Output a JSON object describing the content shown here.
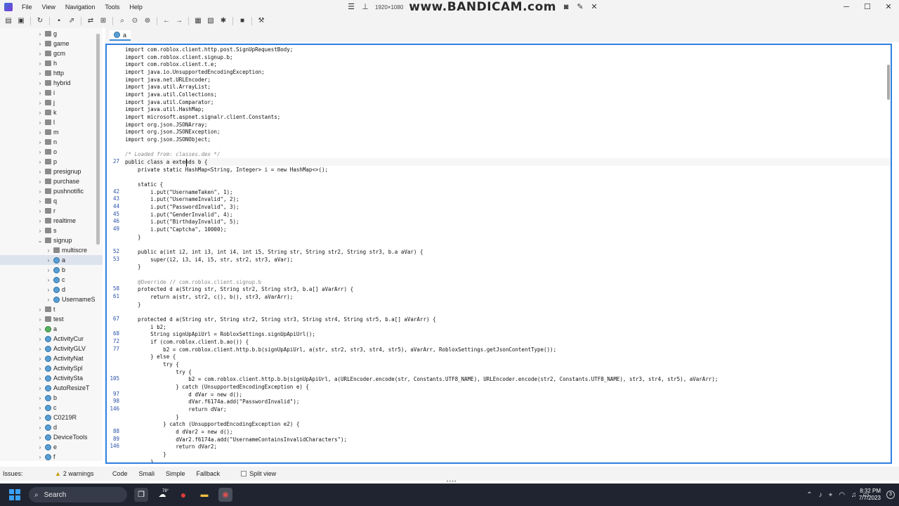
{
  "menubar": {
    "items": [
      "File",
      "View",
      "Navigation",
      "Tools",
      "Help"
    ]
  },
  "recorder": {
    "resolution": "1920×1080",
    "watermark": "www.BANDICAM.com"
  },
  "window_controls": {
    "minimize": "─",
    "maximize": "☐",
    "close": "✕"
  },
  "sidebar": {
    "items": [
      {
        "label": "g",
        "type": "package"
      },
      {
        "label": "game",
        "type": "package"
      },
      {
        "label": "gcm",
        "type": "package"
      },
      {
        "label": "h",
        "type": "package"
      },
      {
        "label": "http",
        "type": "package"
      },
      {
        "label": "hybrid",
        "type": "package"
      },
      {
        "label": "i",
        "type": "package"
      },
      {
        "label": "j",
        "type": "package"
      },
      {
        "label": "k",
        "type": "package"
      },
      {
        "label": "l",
        "type": "package"
      },
      {
        "label": "m",
        "type": "package"
      },
      {
        "label": "n",
        "type": "package"
      },
      {
        "label": "o",
        "type": "package"
      },
      {
        "label": "p",
        "type": "package"
      },
      {
        "label": "presignup",
        "type": "package"
      },
      {
        "label": "purchase",
        "type": "package"
      },
      {
        "label": "pushnotific",
        "type": "package"
      },
      {
        "label": "q",
        "type": "package"
      },
      {
        "label": "r",
        "type": "package"
      },
      {
        "label": "realtime",
        "type": "package"
      },
      {
        "label": "s",
        "type": "package"
      },
      {
        "label": "signup",
        "type": "package-open"
      },
      {
        "label": "multiscre",
        "type": "package"
      },
      {
        "label": "a",
        "type": "class-selected"
      },
      {
        "label": "b",
        "type": "class"
      },
      {
        "label": "c",
        "type": "class"
      },
      {
        "label": "d",
        "type": "class"
      },
      {
        "label": "UsernameS",
        "type": "class"
      },
      {
        "label": "t",
        "type": "package"
      },
      {
        "label": "test",
        "type": "package"
      },
      {
        "label": "a",
        "type": "class-green"
      },
      {
        "label": "ActivityCur",
        "type": "class"
      },
      {
        "label": "ActivityGLV",
        "type": "class"
      },
      {
        "label": "ActivityNat",
        "type": "class"
      },
      {
        "label": "ActivitySpl",
        "type": "class"
      },
      {
        "label": "ActivitySta",
        "type": "class"
      },
      {
        "label": "AutoResizeT",
        "type": "class"
      },
      {
        "label": "b",
        "type": "class"
      },
      {
        "label": "c",
        "type": "class"
      },
      {
        "label": "C0219R",
        "type": "class"
      },
      {
        "label": "d",
        "type": "class"
      },
      {
        "label": "DeviceTools",
        "type": "class"
      },
      {
        "label": "e",
        "type": "class"
      },
      {
        "label": "f",
        "type": "class"
      }
    ]
  },
  "tabs": [
    {
      "label": "a"
    }
  ],
  "code": {
    "lines": [
      {
        "n": "",
        "text": "import com.roblox.client.http.post.SignUpRequestBody;"
      },
      {
        "n": "",
        "text": "import com.roblox.client.signup.b;"
      },
      {
        "n": "",
        "text": "import com.roblox.client.t.e;"
      },
      {
        "n": "",
        "text": "import java.io.UnsupportedEncodingException;"
      },
      {
        "n": "",
        "text": "import java.net.URLEncoder;"
      },
      {
        "n": "",
        "text": "import java.util.ArrayList;"
      },
      {
        "n": "",
        "text": "import java.util.Collections;"
      },
      {
        "n": "",
        "text": "import java.util.Comparator;"
      },
      {
        "n": "",
        "text": "import java.util.HashMap;"
      },
      {
        "n": "",
        "text": "import microsoft.aspnet.signalr.client.Constants;"
      },
      {
        "n": "",
        "text": "import org.json.JSONArray;"
      },
      {
        "n": "",
        "text": "import org.json.JSONException;"
      },
      {
        "n": "",
        "text": "import org.json.JSONObject;"
      },
      {
        "n": "",
        "text": ""
      },
      {
        "n": "",
        "text": "/* Loaded from: classes.dex */",
        "kind": "comment"
      },
      {
        "n": "27",
        "text": "public class a extends b {",
        "kind": "hl"
      },
      {
        "n": "",
        "text": "    private static HashMap<String, Integer> i = new HashMap<>();"
      },
      {
        "n": "",
        "text": ""
      },
      {
        "n": "",
        "text": "    static {"
      },
      {
        "n": "42",
        "text": "        i.put(\"UsernameTaken\", 1);"
      },
      {
        "n": "43",
        "text": "        i.put(\"UsernameInvalid\", 2);"
      },
      {
        "n": "44",
        "text": "        i.put(\"PasswordInvalid\", 3);"
      },
      {
        "n": "45",
        "text": "        i.put(\"GenderInvalid\", 4);"
      },
      {
        "n": "46",
        "text": "        i.put(\"BirthdayInvalid\", 5);"
      },
      {
        "n": "49",
        "text": "        i.put(\"Captcha\", 10000);"
      },
      {
        "n": "",
        "text": "    }"
      },
      {
        "n": "",
        "text": ""
      },
      {
        "n": "52",
        "text": "    public a(int i2, int i3, int i4, int i5, String str, String str2, String str3, b.a aVar) {"
      },
      {
        "n": "53",
        "text": "        super(i2, i3, i4, i5, str, str2, str3, aVar);"
      },
      {
        "n": "",
        "text": "    }"
      },
      {
        "n": "",
        "text": ""
      },
      {
        "n": "",
        "text": "    @Override // com.roblox.client.signup.b",
        "kind": "anno"
      },
      {
        "n": "58",
        "text": "    protected d a(String str, String str2, String str3, b.a[] aVarArr) {"
      },
      {
        "n": "61",
        "text": "        return a(str, str2, c(), b(), str3, aVarArr);"
      },
      {
        "n": "",
        "text": "    }"
      },
      {
        "n": "",
        "text": ""
      },
      {
        "n": "67",
        "text": "    protected d a(String str, String str2, String str3, String str4, String str5, b.a[] aVarArr) {"
      },
      {
        "n": "",
        "text": "        i b2;"
      },
      {
        "n": "68",
        "text": "        String signUpApiUrl = RobloxSettings.signUpApiUrl();"
      },
      {
        "n": "72",
        "text": "        if (com.roblox.client.b.ao()) {"
      },
      {
        "n": "77",
        "text": "            b2 = com.roblox.client.http.b.b(signUpApiUrl, a(str, str2, str3, str4, str5), aVarArr, RobloxSettings.getJsonContentType());"
      },
      {
        "n": "",
        "text": "        } else {"
      },
      {
        "n": "",
        "text": "            try {"
      },
      {
        "n": "",
        "text": "                try {"
      },
      {
        "n": "105",
        "text": "                    b2 = com.roblox.client.http.b.b(signUpApiUrl, a(URLEncoder.encode(str, Constants.UTF8_NAME), URLEncoder.encode(str2, Constants.UTF8_NAME), str3, str4, str5), aVarArr);"
      },
      {
        "n": "",
        "text": "                } catch (UnsupportedEncodingException e) {"
      },
      {
        "n": "97",
        "text": "                    d dVar = new d();"
      },
      {
        "n": "98",
        "text": "                    dVar.f6174a.add(\"PasswordInvalid\");"
      },
      {
        "n": "146",
        "text": "                    return dVar;"
      },
      {
        "n": "",
        "text": "                }"
      },
      {
        "n": "",
        "text": "            } catch (UnsupportedEncodingException e2) {"
      },
      {
        "n": "88",
        "text": "                d dVar2 = new d();"
      },
      {
        "n": "89",
        "text": "                dVar2.f6174a.add(\"UsernameContainsInvalidCharacters\");"
      },
      {
        "n": "146",
        "text": "                return dVar2;"
      },
      {
        "n": "",
        "text": "            }"
      },
      {
        "n": "",
        "text": "        }"
      }
    ]
  },
  "bottom": {
    "issues_label": "Issues:",
    "warnings": "2 warnings",
    "tabs": [
      "Code",
      "Smali",
      "Simple",
      "Fallback"
    ],
    "split_view": "Split view"
  },
  "taskbar": {
    "search_label": "Search",
    "weather_badge": "78°",
    "time": "8:32 PM",
    "date": "7/7/2023",
    "notification_count": "3"
  }
}
